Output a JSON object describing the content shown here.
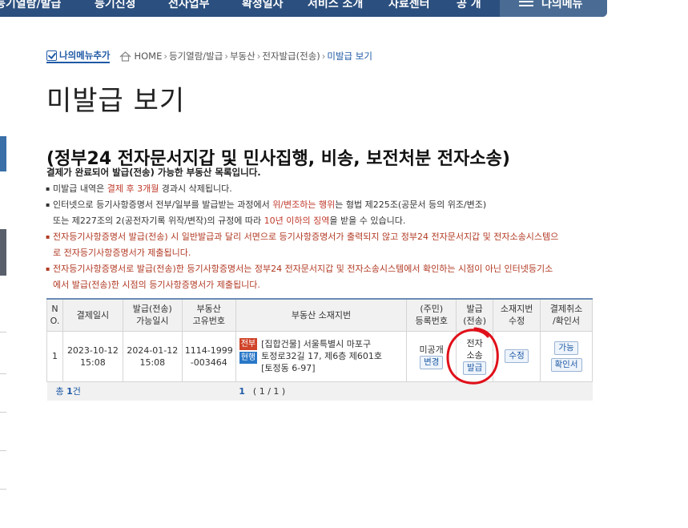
{
  "topnav": {
    "items": [
      "등기열람/발급",
      "등기신청",
      "전자업무",
      "확정일자",
      "서비스 소개",
      "자료센터",
      "공 개"
    ],
    "my_menu": "나의메뉴"
  },
  "breadcrumb": {
    "add_menu": "나의메뉴추가",
    "items": [
      "HOME",
      "등기열람/발급",
      "부동산",
      "전자발급(전송)"
    ],
    "current": "미발급 보기"
  },
  "page_title": "미발급 보기",
  "subheading": "(정부24 전자문서지갑 및 민사집행, 비송, 보전처분 전자소송)",
  "intro": "결제가 완료되어 발급(전송) 가능한 부동산 목록입니다.",
  "notes": {
    "n1_a": "미발급 내역은 ",
    "n1_hl": "결제 후 3개월",
    "n1_b": " 경과시 삭제됩니다.",
    "n2_a": "인터넷으로 등기사항증명서 전부/일부를 발급받는 과정에서 ",
    "n2_hl": "위/변조하는 행위",
    "n2_b": "는 형법 제225조(공문서 등의 위조/변조)",
    "n2_c": "또는 제227조의 2(공전자기록 위작/변작)의 규정에 따라 ",
    "n2_hl2": "10년 이하의 징역",
    "n2_d": "을 받을 수 있습니다.",
    "n3_a": "전자등기사항증명서 발급(전송) 시 일반발급과 달리 서면으로 등기사항증명서가 출력되지 않고 정부24 전자문서지갑 및 전자소송시스템으",
    "n3_b": "로 전자등기사항증명서가 제출됩니다.",
    "n4_a": "전자등기사항증명서로 발급(전송)한 등기사항증명서는 정부24 전자문서지갑 및 전자소송시스템에서 확인하는 시점이 아닌 인터넷등기소",
    "n4_b": "에서 발급(전송)한 시점의 등기사항증명서가 제출됩니다."
  },
  "table": {
    "headers": {
      "no_1": "N",
      "no_2": "O.",
      "paydate": "결제일시",
      "avail_1": "발급(전송)",
      "avail_2": "가능일시",
      "uid_1": "부동산",
      "uid_2": "고유번호",
      "address": "부동산 소재지번",
      "regno_1": "(주민)",
      "regno_2": "등록번호",
      "issue_1": "발급",
      "issue_2": "(전송)",
      "modify_1": "소재지번",
      "modify_2": "수정",
      "cancel_1": "결제취소",
      "cancel_2": "/확인서"
    },
    "rows": [
      {
        "no": "1",
        "paydate_1": "2023-10-12",
        "paydate_2": "15:08",
        "avail_1": "2024-01-12",
        "avail_2": "15:08",
        "uid_1": "1114-1999",
        "uid_2": "-003464",
        "tag_1": "전부",
        "tag_2": "현행",
        "addr_1": "[집합건물] 서울특별시 마포구",
        "addr_2": "토정로32길 17, 제6층 제601호",
        "addr_3": "[토정동 6-97]",
        "regno": "미공개",
        "regno_btn": "변경",
        "issue_1": "전자",
        "issue_2": "소송",
        "issue_btn": "발급",
        "modify_btn": "수정",
        "cancel_btn": "가능",
        "confirm_btn": "확인서"
      }
    ],
    "footer": {
      "total_label": "총 ",
      "total_count": "1",
      "total_unit": "건",
      "page_current": "1",
      "page_info": "( 1 / 1 )"
    }
  },
  "colors": {
    "nav_bg": "#2b4f7e",
    "accent": "#1f5aa6",
    "warning_red": "#b23a24",
    "circle_annotation": "#e0101a"
  }
}
